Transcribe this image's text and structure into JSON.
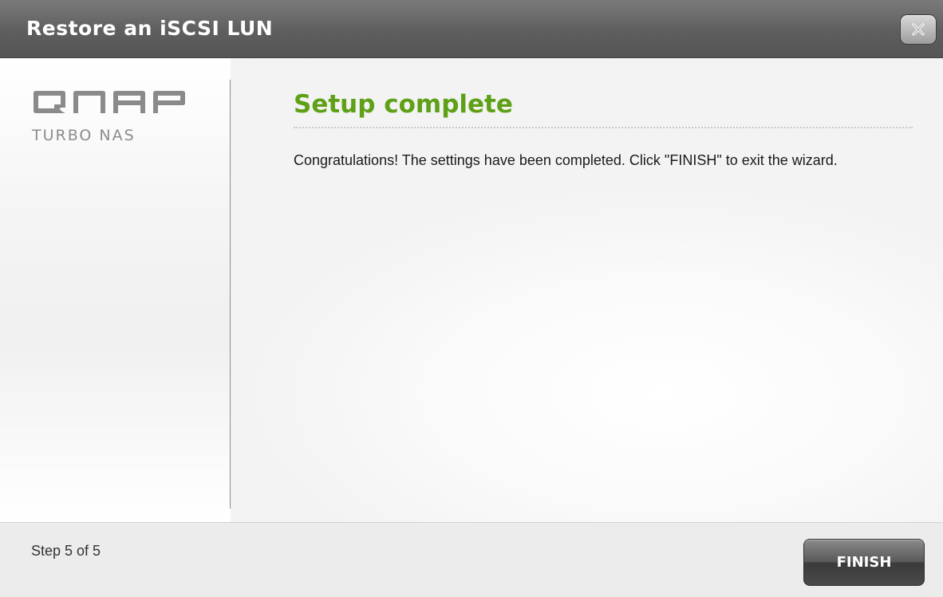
{
  "window": {
    "title": "Restore an iSCSI LUN",
    "close_icon": "close-icon"
  },
  "sidebar": {
    "logo_text": "QNAP",
    "logo_subtitle": "TURBO NAS"
  },
  "content": {
    "heading": "Setup complete",
    "message": "Congratulations! The settings have been completed. Click \"FINISH\" to exit the wizard."
  },
  "footer": {
    "step_text": "Step 5 of 5",
    "finish_label": "FINISH"
  },
  "colors": {
    "heading_green": "#5ea016",
    "titlebar_gray": "#5e5e5e",
    "button_dark": "#4a4a4a"
  }
}
